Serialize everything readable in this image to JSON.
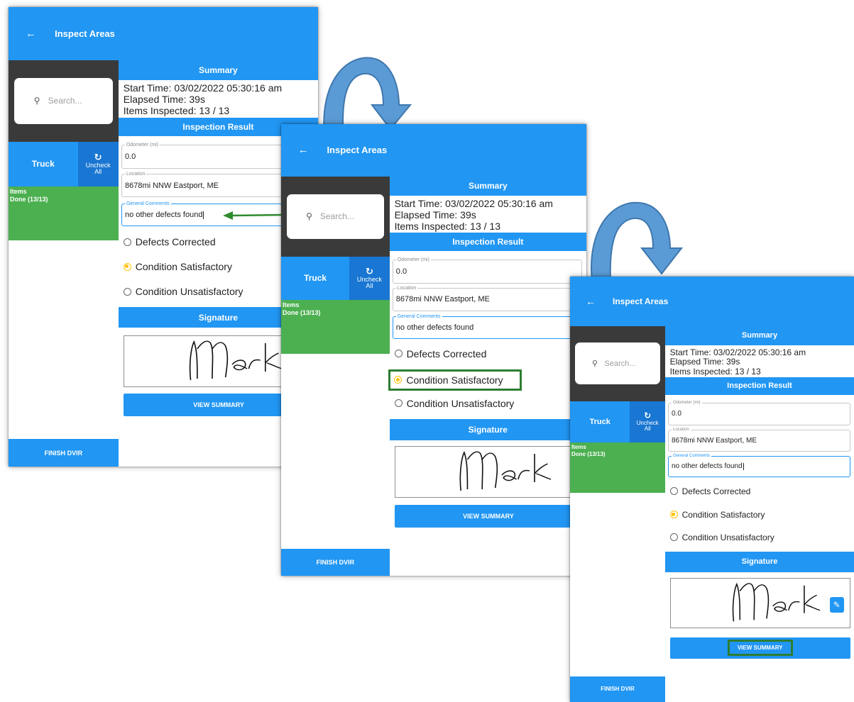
{
  "colors": {
    "app_blue": "#2196F3",
    "items_green": "#4CAF50",
    "search_dark": "#3a3a3a",
    "radio_selected": "#FFC107",
    "highlight_green": "#2E7D32",
    "annotation_arrow": "#5B9BD5"
  },
  "icons": {
    "back": "back-arrow-icon",
    "search": "search-icon",
    "uncheck": "refresh-icon",
    "edit": "pencil-icon",
    "arrow": "curved-arrow-icon"
  },
  "screen": {
    "appbar": {
      "back_glyph": "←",
      "title": "Inspect Areas"
    },
    "sidebar": {
      "search_icon_glyph": "⚲",
      "search_placeholder": "Search...",
      "tab_truck": "Truck",
      "uncheck_icon_glyph": "↻",
      "uncheck_line1": "Uncheck",
      "uncheck_line2": "All",
      "items_title": "Items",
      "items_status": "Done (13/13)",
      "finish_button": "FINISH DVIR"
    },
    "summary": {
      "header": "Summary",
      "start_time": "Start Time: 03/02/2022 05:30:16 am",
      "elapsed": "Elapsed Time: 39s",
      "items_inspected": "Items Inspected: 13 / 13"
    },
    "inspection": {
      "header": "Inspection Result",
      "odometer_label": "Odometer (mi)",
      "odometer_value": "0.0",
      "location_label": "Location",
      "location_value": "8678mi NNW Eastport, ME",
      "comments_label": "General Comments",
      "comments_value": "no other defects found",
      "radio_options": [
        "Defects Corrected",
        "Condition Satisfactory",
        "Condition Unsatisfactory"
      ],
      "selected_option": "Condition Satisfactory"
    },
    "signature": {
      "header": "Signature",
      "edit_glyph": "✎",
      "view_summary_button": "VIEW SUMMARY"
    }
  }
}
